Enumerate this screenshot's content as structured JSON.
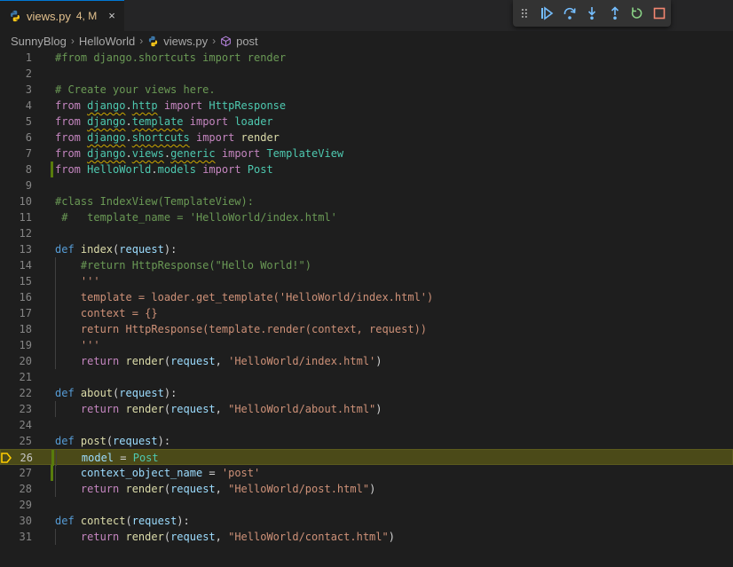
{
  "tab": {
    "filename": "views.py",
    "status": "4, M",
    "close": "×"
  },
  "breadcrumb": {
    "items": [
      "SunnyBlog",
      "HelloWorld",
      "views.py",
      "post"
    ]
  },
  "debug_toolbar": {
    "buttons": [
      "continue",
      "step-over",
      "step-into",
      "step-out",
      "restart",
      "stop"
    ]
  },
  "editor": {
    "current_line": 26,
    "lines": [
      {
        "n": "1",
        "tokens": [
          {
            "t": "#from django.shortcuts import render",
            "c": "cm"
          }
        ]
      },
      {
        "n": "2",
        "tokens": []
      },
      {
        "n": "3",
        "tokens": [
          {
            "t": "# Create your views here.",
            "c": "cm"
          }
        ]
      },
      {
        "n": "4",
        "tokens": [
          {
            "t": "from ",
            "c": "kw"
          },
          {
            "t": "django",
            "c": "cls",
            "sq": true
          },
          {
            "t": ".",
            "c": "pl"
          },
          {
            "t": "http",
            "c": "cls",
            "sq": true
          },
          {
            "t": " import ",
            "c": "kw"
          },
          {
            "t": "HttpResponse",
            "c": "cls"
          }
        ]
      },
      {
        "n": "5",
        "tokens": [
          {
            "t": "from ",
            "c": "kw"
          },
          {
            "t": "django",
            "c": "cls",
            "sq": true
          },
          {
            "t": ".",
            "c": "pl"
          },
          {
            "t": "template",
            "c": "cls",
            "sq": true
          },
          {
            "t": " import ",
            "c": "kw"
          },
          {
            "t": "loader",
            "c": "cls"
          }
        ]
      },
      {
        "n": "6",
        "tokens": [
          {
            "t": "from ",
            "c": "kw"
          },
          {
            "t": "django",
            "c": "cls",
            "sq": true
          },
          {
            "t": ".",
            "c": "pl"
          },
          {
            "t": "shortcuts",
            "c": "cls",
            "sq": true
          },
          {
            "t": " import ",
            "c": "kw"
          },
          {
            "t": "render",
            "c": "fn"
          }
        ]
      },
      {
        "n": "7",
        "tokens": [
          {
            "t": "from ",
            "c": "kw"
          },
          {
            "t": "django",
            "c": "cls",
            "sq": true
          },
          {
            "t": ".",
            "c": "pl"
          },
          {
            "t": "views",
            "c": "cls",
            "sq": true
          },
          {
            "t": ".",
            "c": "pl"
          },
          {
            "t": "generic",
            "c": "cls",
            "sq": true
          },
          {
            "t": " import ",
            "c": "kw"
          },
          {
            "t": "TemplateView",
            "c": "cls"
          }
        ]
      },
      {
        "n": "8",
        "mod": true,
        "tokens": [
          {
            "t": "from ",
            "c": "kw"
          },
          {
            "t": "HelloWorld",
            "c": "cls"
          },
          {
            "t": ".",
            "c": "pl"
          },
          {
            "t": "models",
            "c": "cls"
          },
          {
            "t": " import ",
            "c": "kw"
          },
          {
            "t": "Post",
            "c": "cls"
          }
        ]
      },
      {
        "n": "9",
        "tokens": []
      },
      {
        "n": "10",
        "tokens": [
          {
            "t": "#class IndexView(TemplateView):",
            "c": "cm"
          }
        ]
      },
      {
        "n": "11",
        "tokens": [
          {
            "t": " #   template_name = 'HelloWorld/index.html'",
            "c": "cm"
          }
        ]
      },
      {
        "n": "12",
        "tokens": []
      },
      {
        "n": "13",
        "tokens": [
          {
            "t": "def ",
            "c": "def"
          },
          {
            "t": "index",
            "c": "fn"
          },
          {
            "t": "(",
            "c": "pl"
          },
          {
            "t": "request",
            "c": "var"
          },
          {
            "t": "):",
            "c": "pl"
          }
        ]
      },
      {
        "n": "14",
        "indent": true,
        "tokens": [
          {
            "t": "    #return HttpResponse(\"Hello World!\")",
            "c": "cm"
          }
        ]
      },
      {
        "n": "15",
        "indent": true,
        "tokens": [
          {
            "t": "    '''",
            "c": "str"
          }
        ]
      },
      {
        "n": "16",
        "indent": true,
        "tokens": [
          {
            "t": "    template = loader.get_template('HelloWorld/index.html')",
            "c": "str"
          }
        ]
      },
      {
        "n": "17",
        "indent": true,
        "tokens": [
          {
            "t": "    context = {}",
            "c": "str"
          }
        ]
      },
      {
        "n": "18",
        "indent": true,
        "tokens": [
          {
            "t": "    return HttpResponse(template.render(context, request))",
            "c": "str"
          }
        ]
      },
      {
        "n": "19",
        "indent": true,
        "tokens": [
          {
            "t": "    '''",
            "c": "str"
          }
        ]
      },
      {
        "n": "20",
        "indent": true,
        "tokens": [
          {
            "t": "    ",
            "c": "pl"
          },
          {
            "t": "return ",
            "c": "kw"
          },
          {
            "t": "render",
            "c": "fn"
          },
          {
            "t": "(",
            "c": "pl"
          },
          {
            "t": "request",
            "c": "var"
          },
          {
            "t": ", ",
            "c": "pl"
          },
          {
            "t": "'HelloWorld/index.html'",
            "c": "str"
          },
          {
            "t": ")",
            "c": "pl"
          }
        ]
      },
      {
        "n": "21",
        "tokens": []
      },
      {
        "n": "22",
        "tokens": [
          {
            "t": "def ",
            "c": "def"
          },
          {
            "t": "about",
            "c": "fn"
          },
          {
            "t": "(",
            "c": "pl"
          },
          {
            "t": "request",
            "c": "var"
          },
          {
            "t": "):",
            "c": "pl"
          }
        ]
      },
      {
        "n": "23",
        "indent": true,
        "tokens": [
          {
            "t": "    ",
            "c": "pl"
          },
          {
            "t": "return ",
            "c": "kw"
          },
          {
            "t": "render",
            "c": "fn"
          },
          {
            "t": "(",
            "c": "pl"
          },
          {
            "t": "request",
            "c": "var"
          },
          {
            "t": ", ",
            "c": "pl"
          },
          {
            "t": "\"HelloWorld/about.html\"",
            "c": "str"
          },
          {
            "t": ")",
            "c": "pl"
          }
        ]
      },
      {
        "n": "24",
        "tokens": []
      },
      {
        "n": "25",
        "tokens": [
          {
            "t": "def ",
            "c": "def"
          },
          {
            "t": "post",
            "c": "fn"
          },
          {
            "t": "(",
            "c": "pl"
          },
          {
            "t": "request",
            "c": "var"
          },
          {
            "t": "):",
            "c": "pl"
          }
        ]
      },
      {
        "n": "26",
        "indent": true,
        "current": true,
        "mod": true,
        "tokens": [
          {
            "t": "    ",
            "c": "pl"
          },
          {
            "t": "model",
            "c": "var"
          },
          {
            "t": " = ",
            "c": "pl"
          },
          {
            "t": "Post",
            "c": "cls"
          }
        ]
      },
      {
        "n": "27",
        "indent": true,
        "mod": true,
        "tokens": [
          {
            "t": "    ",
            "c": "pl"
          },
          {
            "t": "context_object_name",
            "c": "var"
          },
          {
            "t": " = ",
            "c": "pl"
          },
          {
            "t": "'post'",
            "c": "str"
          }
        ]
      },
      {
        "n": "28",
        "indent": true,
        "tokens": [
          {
            "t": "    ",
            "c": "pl"
          },
          {
            "t": "return ",
            "c": "kw"
          },
          {
            "t": "render",
            "c": "fn"
          },
          {
            "t": "(",
            "c": "pl"
          },
          {
            "t": "request",
            "c": "var"
          },
          {
            "t": ", ",
            "c": "pl"
          },
          {
            "t": "\"HelloWorld/post.html\"",
            "c": "str"
          },
          {
            "t": ")",
            "c": "pl"
          }
        ]
      },
      {
        "n": "29",
        "tokens": []
      },
      {
        "n": "30",
        "tokens": [
          {
            "t": "def ",
            "c": "def"
          },
          {
            "t": "contect",
            "c": "fn"
          },
          {
            "t": "(",
            "c": "pl"
          },
          {
            "t": "request",
            "c": "var"
          },
          {
            "t": "):",
            "c": "pl"
          }
        ]
      },
      {
        "n": "31",
        "indent": true,
        "tokens": [
          {
            "t": "    ",
            "c": "pl"
          },
          {
            "t": "return ",
            "c": "kw"
          },
          {
            "t": "render",
            "c": "fn"
          },
          {
            "t": "(",
            "c": "pl"
          },
          {
            "t": "request",
            "c": "var"
          },
          {
            "t": ", ",
            "c": "pl"
          },
          {
            "t": "\"HelloWorld/contact.html\"",
            "c": "str"
          },
          {
            "t": ")",
            "c": "pl"
          }
        ]
      }
    ]
  }
}
